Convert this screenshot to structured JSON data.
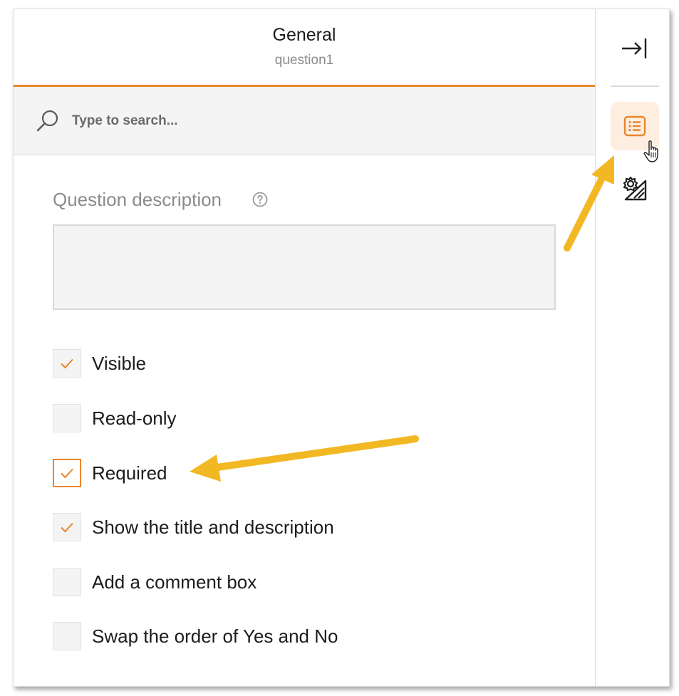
{
  "header": {
    "title": "General",
    "subtitle": "question1"
  },
  "search": {
    "placeholder": "Type to search..."
  },
  "description": {
    "label": "Question description",
    "value": ""
  },
  "checkboxes": [
    {
      "label": "Visible",
      "checked": true,
      "focused": false
    },
    {
      "label": "Read-only",
      "checked": false,
      "focused": false
    },
    {
      "label": "Required",
      "checked": true,
      "focused": true
    },
    {
      "label": "Show the title and description",
      "checked": true,
      "focused": false
    },
    {
      "label": "Add a comment box",
      "checked": false,
      "focused": false
    },
    {
      "label": "Swap the order of Yes and No",
      "checked": false,
      "focused": false
    }
  ],
  "rail": {
    "icons": [
      "collapse-panel-icon",
      "general-properties-icon",
      "logic-settings-icon"
    ],
    "active": "general-properties-icon"
  },
  "colors": {
    "accent": "#e8852b",
    "accent_soft": "#fdeee0",
    "annotation_arrow": "#f2b824",
    "field_bg": "#f4f4f4"
  }
}
